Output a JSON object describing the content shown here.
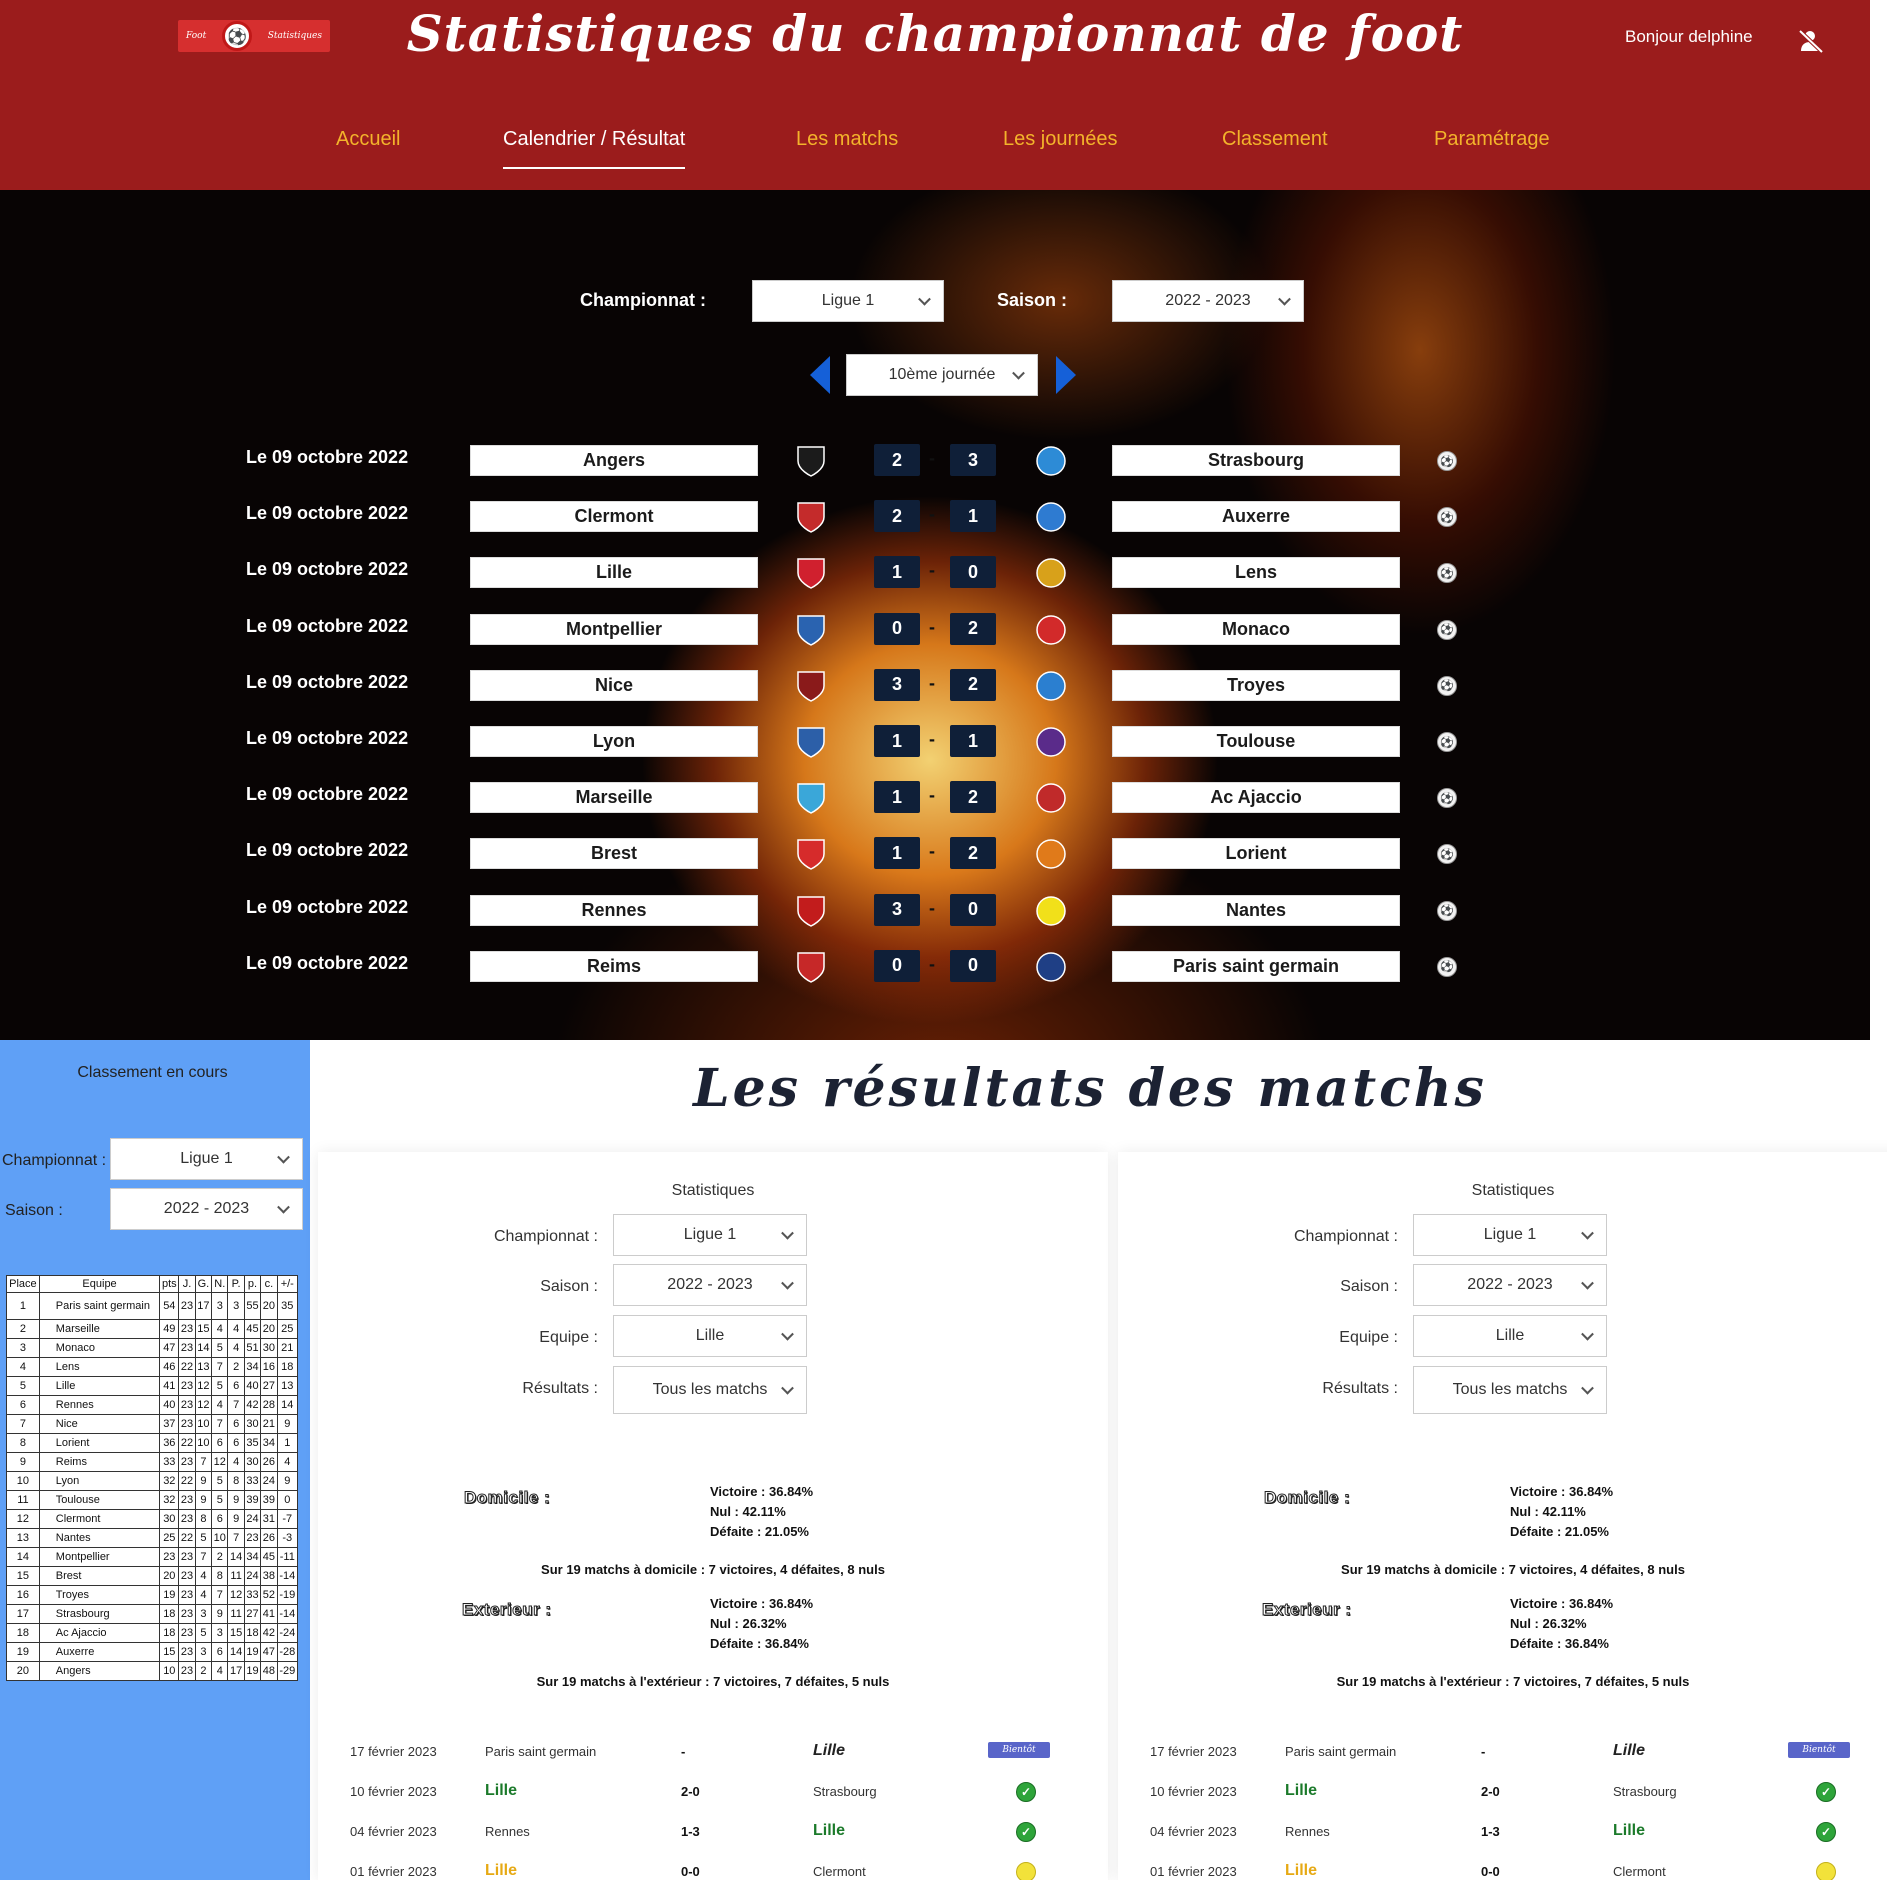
{
  "header": {
    "logo_left": "Foot",
    "logo_right": "Statistiques",
    "title": "Statistiques du championnat de foot",
    "greeting": "Bonjour delphine",
    "user_icon": "user-slash-icon"
  },
  "nav": [
    {
      "label": "Accueil",
      "active": false
    },
    {
      "label": "Calendrier / Résultat",
      "active": true
    },
    {
      "label": "Les matchs",
      "active": false
    },
    {
      "label": "Les journées",
      "active": false
    },
    {
      "label": "Classement",
      "active": false
    },
    {
      "label": "Paramétrage",
      "active": false
    }
  ],
  "filters": {
    "championship_label": "Championnat :",
    "championship_value": "Ligue 1",
    "season_label": "Saison :",
    "season_value": "2022 - 2023",
    "matchday_value": "10ème journée"
  },
  "matches": [
    {
      "date": "Le 09 octobre 2022",
      "home": "Angers",
      "home_score": "2",
      "away_score": "3",
      "away": "Strasbourg"
    },
    {
      "date": "Le 09 octobre 2022",
      "home": "Clermont",
      "home_score": "2",
      "away_score": "1",
      "away": "Auxerre"
    },
    {
      "date": "Le 09 octobre 2022",
      "home": "Lille",
      "home_score": "1",
      "away_score": "0",
      "away": "Lens"
    },
    {
      "date": "Le 09 octobre 2022",
      "home": "Montpellier",
      "home_score": "0",
      "away_score": "2",
      "away": "Monaco"
    },
    {
      "date": "Le 09 octobre 2022",
      "home": "Nice",
      "home_score": "3",
      "away_score": "2",
      "away": "Troyes"
    },
    {
      "date": "Le 09 octobre 2022",
      "home": "Lyon",
      "home_score": "1",
      "away_score": "1",
      "away": "Toulouse"
    },
    {
      "date": "Le 09 octobre 2022",
      "home": "Marseille",
      "home_score": "1",
      "away_score": "2",
      "away": "Ac Ajaccio"
    },
    {
      "date": "Le 09 octobre 2022",
      "home": "Brest",
      "home_score": "1",
      "away_score": "2",
      "away": "Lorient"
    },
    {
      "date": "Le 09 octobre 2022",
      "home": "Rennes",
      "home_score": "3",
      "away_score": "0",
      "away": "Nantes"
    },
    {
      "date": "Le 09 octobre 2022",
      "home": "Reims",
      "home_score": "0",
      "away_score": "0",
      "away": "Paris saint germain"
    }
  ],
  "sidebar": {
    "title": "Classement en cours",
    "championship_label": "Championnat :",
    "championship_value": "Ligue 1",
    "season_label": "Saison :",
    "season_value": "2022 - 2023",
    "table_headers": [
      "Place",
      "Equipe",
      "pts",
      "J.",
      "G.",
      "N.",
      "P.",
      "p.",
      "c.",
      "+/-"
    ],
    "standings": [
      [
        "1",
        "Paris saint germain",
        "54",
        "23",
        "17",
        "3",
        "3",
        "55",
        "20",
        "35"
      ],
      [
        "2",
        "Marseille",
        "49",
        "23",
        "15",
        "4",
        "4",
        "45",
        "20",
        "25"
      ],
      [
        "3",
        "Monaco",
        "47",
        "23",
        "14",
        "5",
        "4",
        "51",
        "30",
        "21"
      ],
      [
        "4",
        "Lens",
        "46",
        "22",
        "13",
        "7",
        "2",
        "34",
        "16",
        "18"
      ],
      [
        "5",
        "Lille",
        "41",
        "23",
        "12",
        "5",
        "6",
        "40",
        "27",
        "13"
      ],
      [
        "6",
        "Rennes",
        "40",
        "23",
        "12",
        "4",
        "7",
        "42",
        "28",
        "14"
      ],
      [
        "7",
        "Nice",
        "37",
        "23",
        "10",
        "7",
        "6",
        "30",
        "21",
        "9"
      ],
      [
        "8",
        "Lorient",
        "36",
        "22",
        "10",
        "6",
        "6",
        "35",
        "34",
        "1"
      ],
      [
        "9",
        "Reims",
        "33",
        "23",
        "7",
        "12",
        "4",
        "30",
        "26",
        "4"
      ],
      [
        "10",
        "Lyon",
        "32",
        "22",
        "9",
        "5",
        "8",
        "33",
        "24",
        "9"
      ],
      [
        "11",
        "Toulouse",
        "32",
        "23",
        "9",
        "5",
        "9",
        "39",
        "39",
        "0"
      ],
      [
        "12",
        "Clermont",
        "30",
        "23",
        "8",
        "6",
        "9",
        "24",
        "31",
        "-7"
      ],
      [
        "13",
        "Nantes",
        "25",
        "22",
        "5",
        "10",
        "7",
        "23",
        "26",
        "-3"
      ],
      [
        "14",
        "Montpellier",
        "23",
        "23",
        "7",
        "2",
        "14",
        "34",
        "45",
        "-11"
      ],
      [
        "15",
        "Brest",
        "20",
        "23",
        "4",
        "8",
        "11",
        "24",
        "38",
        "-14"
      ],
      [
        "16",
        "Troyes",
        "19",
        "23",
        "4",
        "7",
        "12",
        "33",
        "52",
        "-19"
      ],
      [
        "17",
        "Strasbourg",
        "18",
        "23",
        "3",
        "9",
        "11",
        "27",
        "41",
        "-14"
      ],
      [
        "18",
        "Ac Ajaccio",
        "18",
        "23",
        "5",
        "3",
        "15",
        "18",
        "42",
        "-24"
      ],
      [
        "19",
        "Auxerre",
        "15",
        "23",
        "3",
        "6",
        "14",
        "19",
        "47",
        "-28"
      ],
      [
        "20",
        "Angers",
        "10",
        "23",
        "2",
        "4",
        "17",
        "19",
        "48",
        "-29"
      ]
    ]
  },
  "results": {
    "title": "Les résultats des matchs",
    "panels": [
      {
        "title": "Statistiques",
        "championship_label": "Championnat :",
        "championship_value": "Ligue 1",
        "season_label": "Saison :",
        "season_value": "2022 - 2023",
        "team_label": "Equipe :",
        "team_value": "Lille",
        "results_label": "Résultats :",
        "results_value": "Tous les matchs",
        "home_badge": "Domicile :",
        "home_win": "Victoire : 36.84%",
        "home_draw": "Nul : 42.11%",
        "home_loss": "Défaite : 21.05%",
        "home_summary": "Sur 19 matchs à domicile : 7 victoires, 4 défaites, 8 nuls",
        "away_badge": "Exterieur :",
        "away_win": "Victoire : 36.84%",
        "away_draw": "Nul : 26.32%",
        "away_loss": "Défaite : 36.84%",
        "away_summary": "Sur 19 matchs à l'extérieur : 7 victoires, 7 défaites, 5 nuls",
        "rows": [
          {
            "date": "17 février 2023",
            "home": "Paris saint germain",
            "score": "-",
            "away": "Lille",
            "status": "Bientôt"
          },
          {
            "date": "10 février 2023",
            "home": "Lille",
            "score": "2-0",
            "away": "Strasbourg",
            "status": "win"
          },
          {
            "date": "04 février 2023",
            "home": "Rennes",
            "score": "1-3",
            "away": "Lille",
            "status": "win"
          },
          {
            "date": "01 février 2023",
            "home": "Lille",
            "score": "0-0",
            "away": "Clermont",
            "status": "draw"
          }
        ]
      },
      {
        "title": "Statistiques",
        "championship_label": "Championnat :",
        "championship_value": "Ligue 1",
        "season_label": "Saison :",
        "season_value": "2022 - 2023",
        "team_label": "Equipe :",
        "team_value": "Lille",
        "results_label": "Résultats :",
        "results_value": "Tous les matchs",
        "home_badge": "Domicile :",
        "home_win": "Victoire : 36.84%",
        "home_draw": "Nul : 42.11%",
        "home_loss": "Défaite : 21.05%",
        "home_summary": "Sur 19 matchs à domicile : 7 victoires, 4 défaites, 8 nuls",
        "away_badge": "Exterieur :",
        "away_win": "Victoire : 36.84%",
        "away_draw": "Nul : 26.32%",
        "away_loss": "Défaite : 36.84%",
        "away_summary": "Sur 19 matchs à l'extérieur : 7 victoires, 7 défaites, 5 nuls",
        "rows": [
          {
            "date": "17 février 2023",
            "home": "Paris saint germain",
            "score": "-",
            "away": "Lille",
            "status": "Bientôt"
          },
          {
            "date": "10 février 2023",
            "home": "Lille",
            "score": "2-0",
            "away": "Strasbourg",
            "status": "win"
          },
          {
            "date": "04 février 2023",
            "home": "Rennes",
            "score": "1-3",
            "away": "Lille",
            "status": "win"
          },
          {
            "date": "01 février 2023",
            "home": "Lille",
            "score": "0-0",
            "away": "Clermont",
            "status": "draw"
          }
        ]
      }
    ]
  },
  "crest_colors": [
    "#1b1b1b",
    "#c42b2b",
    "#d0202e",
    "#2a63b0",
    "#8a1a1a",
    "#2c5fa8",
    "#3aa7d9",
    "#d62b2b",
    "#c21c1c",
    "#c62828"
  ],
  "away_crest_colors": [
    "#2d8bd6",
    "#2e7bd1",
    "#d8a11a",
    "#d22a2a",
    "#2b7fd0",
    "#5a2b8a",
    "#c02a2a",
    "#e07a1a",
    "#f1e01a",
    "#1f3f85"
  ]
}
